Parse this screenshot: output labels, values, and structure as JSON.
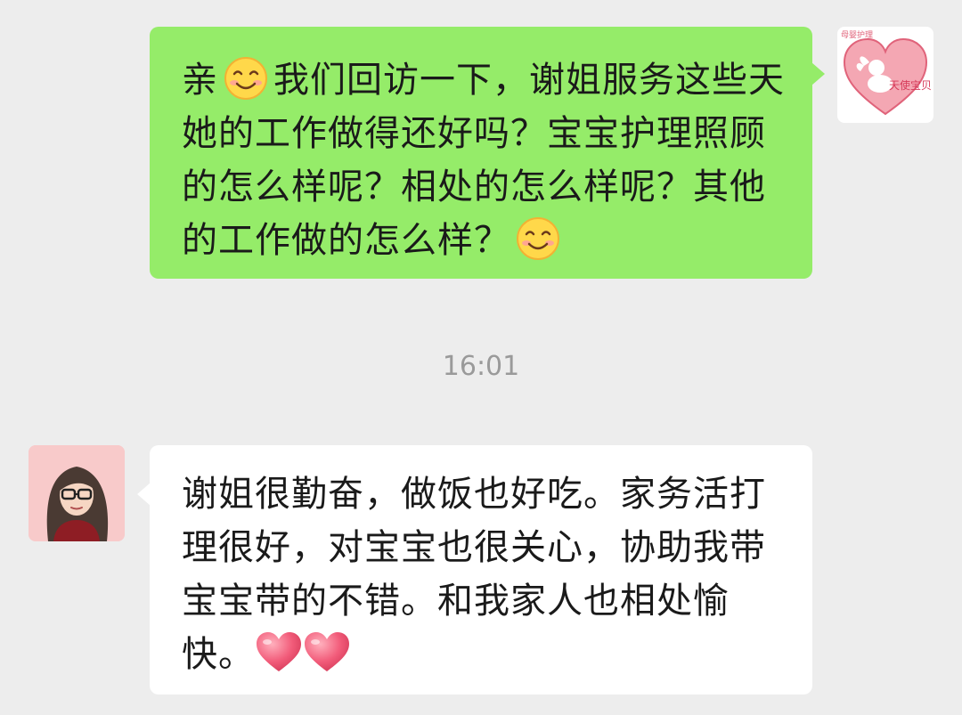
{
  "chat": {
    "outgoing": {
      "text_before_emoji": "亲",
      "text_after_emoji": "我们回访一下，谢姐服务这些天她的工作做得还好吗？宝宝护理照顾的怎么样呢？相处的怎么样呢？其他的工作做的怎么样？",
      "emoji_start": "smiling-face-emoji",
      "emoji_end": "smiling-face-emoji"
    },
    "timestamp": "16:01",
    "incoming": {
      "text": "谢姐很勤奋，做饭也好吃。家务活打理很好，对宝宝也很关心，协助我带宝宝带的不错。和我家人也相处愉快。",
      "emojis": [
        "heart-emoji",
        "heart-emoji"
      ]
    }
  },
  "avatars": {
    "right": {
      "brand_small_text": "母婴护理",
      "brand_text": "天使宝贝"
    },
    "left": {
      "description": "woman-with-glasses"
    }
  },
  "colors": {
    "background": "#ededed",
    "outgoing_bubble": "#95ec69",
    "incoming_bubble": "#ffffff",
    "timestamp_text": "#9a9a9a"
  }
}
